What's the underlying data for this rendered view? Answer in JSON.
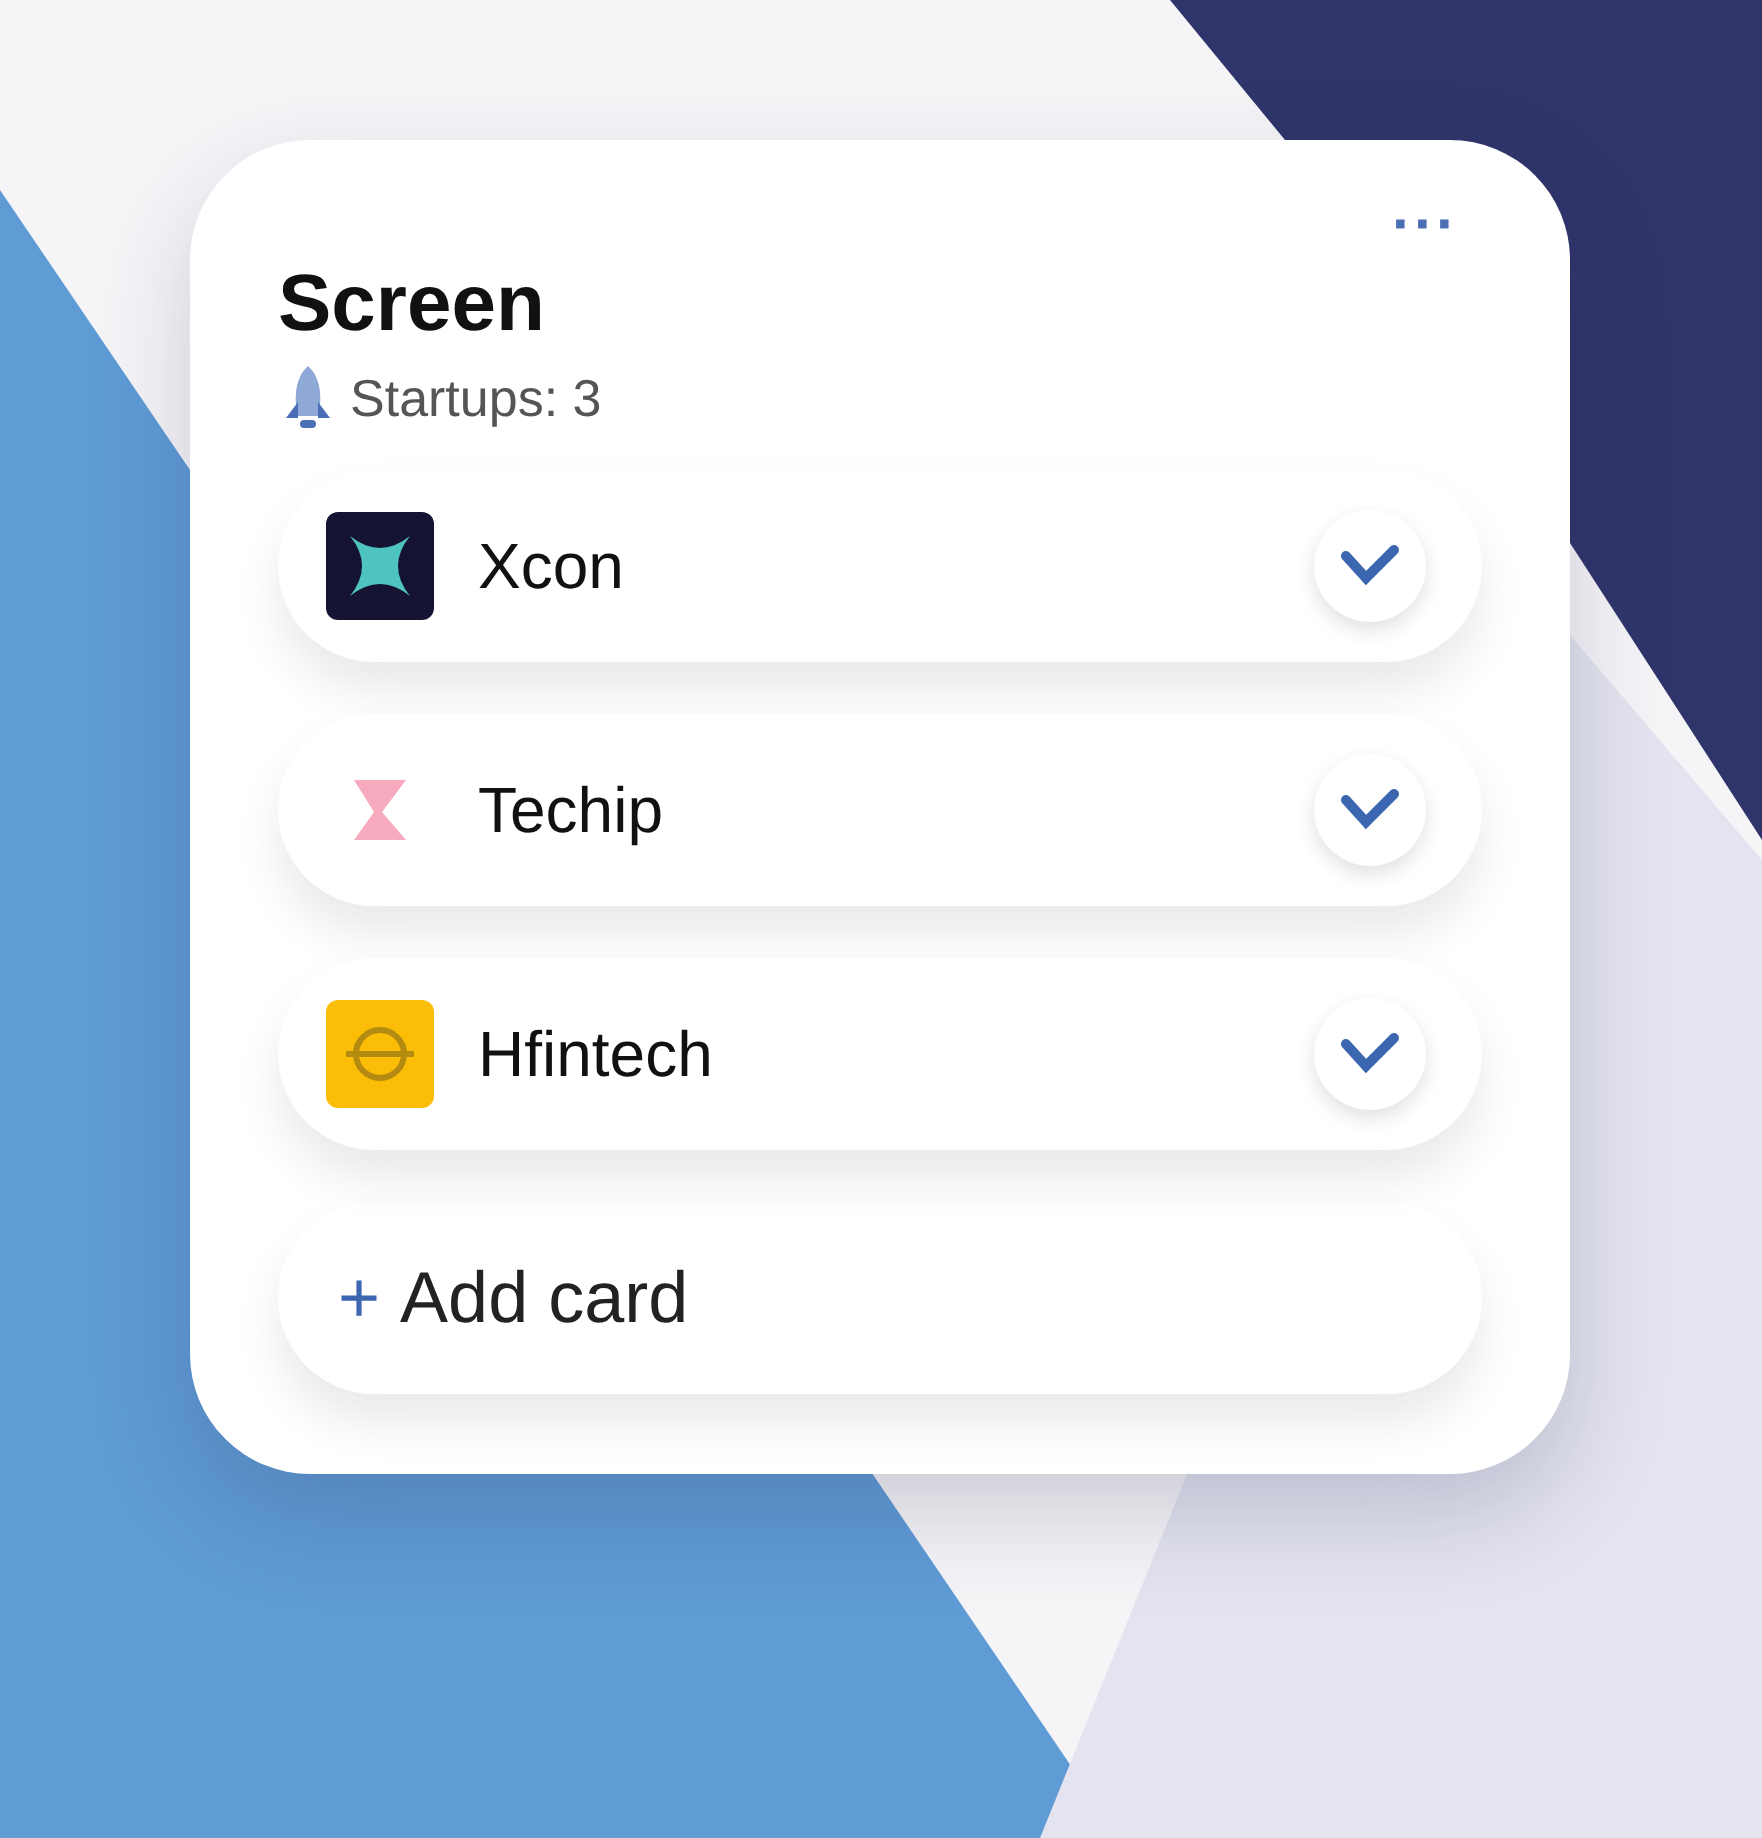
{
  "board": {
    "title": "Screen",
    "subtitle": "Startups: 3",
    "menu": "···",
    "cards": [
      {
        "name": "Xcon",
        "kind": "x",
        "checked": true
      },
      {
        "name": "Techip",
        "kind": "hourglass",
        "checked": true
      },
      {
        "name": "Hfintech",
        "kind": "circle",
        "checked": true
      }
    ],
    "add_button": {
      "icon": "+",
      "label": "Add card"
    }
  }
}
